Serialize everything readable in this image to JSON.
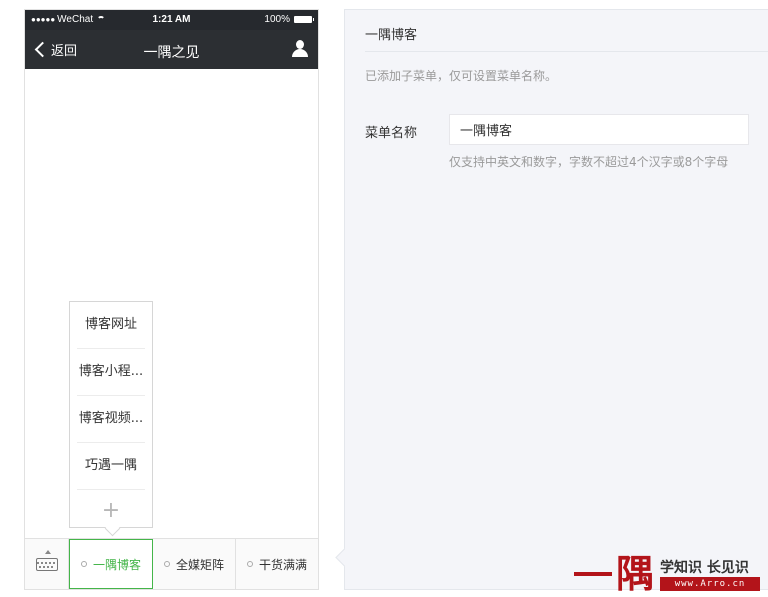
{
  "status_bar": {
    "signal_dots": "●●●●●",
    "carrier": "WeChat",
    "time": "1:21 AM",
    "battery": "100%"
  },
  "nav_bar": {
    "back_label": "返回",
    "title": "一隅之见"
  },
  "submenu": {
    "items": [
      "博客网址",
      "博客小程...",
      "博客视频...",
      "巧遇一隅"
    ],
    "add_symbol": "+"
  },
  "menu_bar": {
    "tabs": [
      {
        "label": "一隅博客",
        "active": true
      },
      {
        "label": "全媒矩阵",
        "active": false
      },
      {
        "label": "干货满满",
        "active": false
      }
    ]
  },
  "editor": {
    "title": "一隅博客",
    "hint": "已添加子菜单，仅可设置菜单名称。",
    "name_label": "菜单名称",
    "name_value": "一隅博客",
    "name_note": "仅支持中英文和数字，字数不超过4个汉字或8个字母"
  },
  "watermark": {
    "glyph": "隅",
    "slogan": "学知识 长见识",
    "url": "www.Arro.cn"
  },
  "colors": {
    "accent_green": "#44b549",
    "nav_dark": "#2c2f33",
    "brand_red": "#b3141a"
  }
}
